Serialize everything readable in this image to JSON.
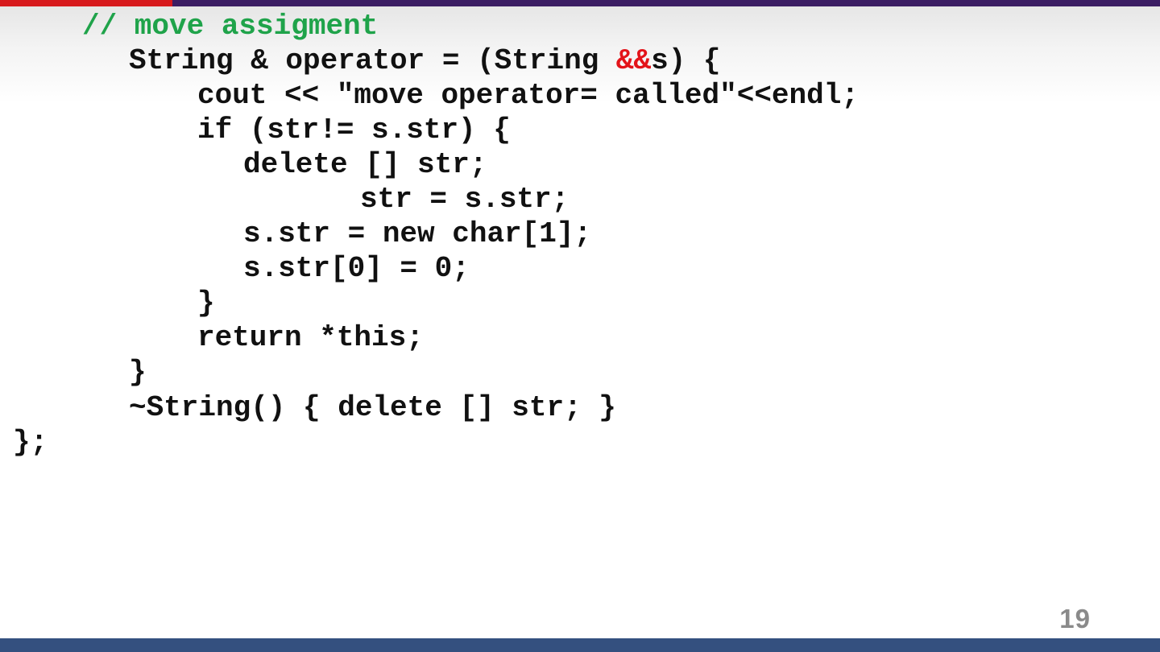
{
  "slide": {
    "page_number": "19",
    "colors": {
      "top_bar_left": "#d7191c",
      "top_bar_right": "#3b1d63",
      "bottom_bar": "#34507f",
      "comment": "#1fa34a",
      "highlight": "#e3141a",
      "code_text": "#111111",
      "page_number": "#8a8a8a"
    },
    "code": {
      "comment_line": "// move assigment",
      "operator_prefix": "String & operator = (String ",
      "operator_highlight": "&&",
      "operator_suffix": "s) {",
      "lines": [
        "cout << \"move operator= called\"<<endl;",
        "if (str!= s.str) {",
        "delete [] str;",
        "str = s.str;",
        "s.str = new char[1];",
        "s.str[0] = 0;",
        "}",
        "return *this;",
        "}",
        "~String() { delete [] str; }",
        "};"
      ]
    }
  }
}
